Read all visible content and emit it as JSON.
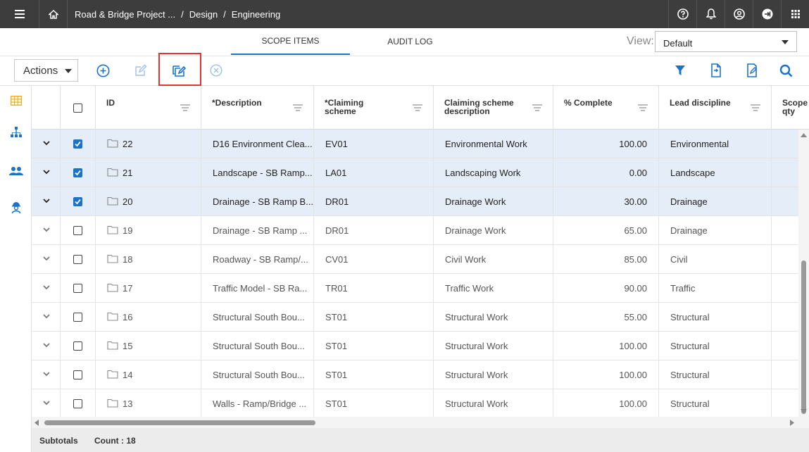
{
  "topbar": {
    "breadcrumbs": [
      "Road & Bridge Project ...",
      "Design",
      "Engineering"
    ],
    "separator": "/",
    "icons": [
      "menu-icon",
      "home-icon",
      "help-icon",
      "bell-icon",
      "user-icon",
      "signout-icon",
      "apps-grid-icon"
    ]
  },
  "tabs": [
    {
      "label": "SCOPE ITEMS",
      "active": true
    },
    {
      "label": "AUDIT LOG",
      "active": false
    }
  ],
  "view": {
    "label": "View:",
    "value": "Default"
  },
  "toolbar": {
    "actions_label": "Actions",
    "icons": [
      "add-icon",
      "edit-icon",
      "bulk-edit-icon",
      "cancel-icon",
      "filter-icon",
      "export-icon",
      "import-icon",
      "search-icon"
    ]
  },
  "columns": [
    "ID",
    "*Description",
    "*Claiming scheme",
    "Claiming scheme description",
    "% Complete",
    "Lead discipline",
    "Scope qty"
  ],
  "rows": [
    {
      "id": "22",
      "description": "D16 Environment Clea...",
      "scheme": "EV01",
      "scheme_desc": "Environmental Work",
      "complete": "100.00",
      "discipline": "Environmental",
      "selected": true
    },
    {
      "id": "21",
      "description": "Landscape - SB Ramp...",
      "scheme": "LA01",
      "scheme_desc": "Landscaping Work",
      "complete": "0.00",
      "discipline": "Landscape",
      "selected": true
    },
    {
      "id": "20",
      "description": "Drainage - SB Ramp B...",
      "scheme": "DR01",
      "scheme_desc": "Drainage Work",
      "complete": "30.00",
      "discipline": "Drainage",
      "selected": true
    },
    {
      "id": "19",
      "description": "Drainage - SB Ramp ...",
      "scheme": "DR01",
      "scheme_desc": "Drainage Work",
      "complete": "65.00",
      "discipline": "Drainage",
      "selected": false
    },
    {
      "id": "18",
      "description": "Roadway - SB Ramp/...",
      "scheme": "CV01",
      "scheme_desc": "Civil Work",
      "complete": "85.00",
      "discipline": "Civil",
      "selected": false
    },
    {
      "id": "17",
      "description": "Traffic Model - SB Ra...",
      "scheme": "TR01",
      "scheme_desc": "Traffic Work",
      "complete": "90.00",
      "discipline": "Traffic",
      "selected": false
    },
    {
      "id": "16",
      "description": "Structural South Bou...",
      "scheme": "ST01",
      "scheme_desc": "Structural Work",
      "complete": "55.00",
      "discipline": "Structural",
      "selected": false
    },
    {
      "id": "15",
      "description": "Structural South Bou...",
      "scheme": "ST01",
      "scheme_desc": "Structural Work",
      "complete": "100.00",
      "discipline": "Structural",
      "selected": false
    },
    {
      "id": "14",
      "description": "Structural South Bou...",
      "scheme": "ST01",
      "scheme_desc": "Structural Work",
      "complete": "100.00",
      "discipline": "Structural",
      "selected": false
    },
    {
      "id": "13",
      "description": "Walls - Ramp/Bridge ...",
      "scheme": "ST01",
      "scheme_desc": "Structural Work",
      "complete": "100.00",
      "discipline": "Structural",
      "selected": false
    }
  ],
  "footer": {
    "subtotals_label": "Subtotals",
    "count_label": "Count : 18"
  },
  "colors": {
    "accent": "#1a73c8",
    "topbar": "#3d3d3d",
    "selected_row": "#e5eef8",
    "highlight": "#e23434",
    "sidenav_active": "#f2b01e"
  }
}
